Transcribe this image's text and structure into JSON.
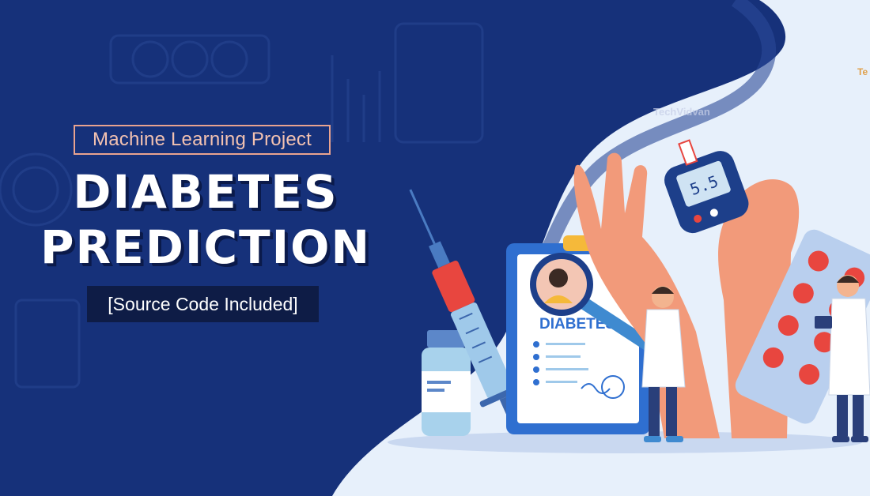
{
  "banner": {
    "tag_label": "Machine Learning Project",
    "title_line1": "DIABETES",
    "title_line2": "PREDICTION",
    "subtitle": "[Source Code Included]"
  },
  "illustration": {
    "clipboard_heading": "DIABETES",
    "glucometer_reading": "5.5",
    "watermark_text": "TechVidvan",
    "corner_logo_text": "Te"
  },
  "colors": {
    "background_navy": "#16317a",
    "panel_light": "#e7f0fb",
    "accent_salmon": "#e9a38f",
    "skin": "#f29a7a",
    "syringe_red": "#e8463f",
    "clipboard_blue": "#2f6fd0"
  }
}
